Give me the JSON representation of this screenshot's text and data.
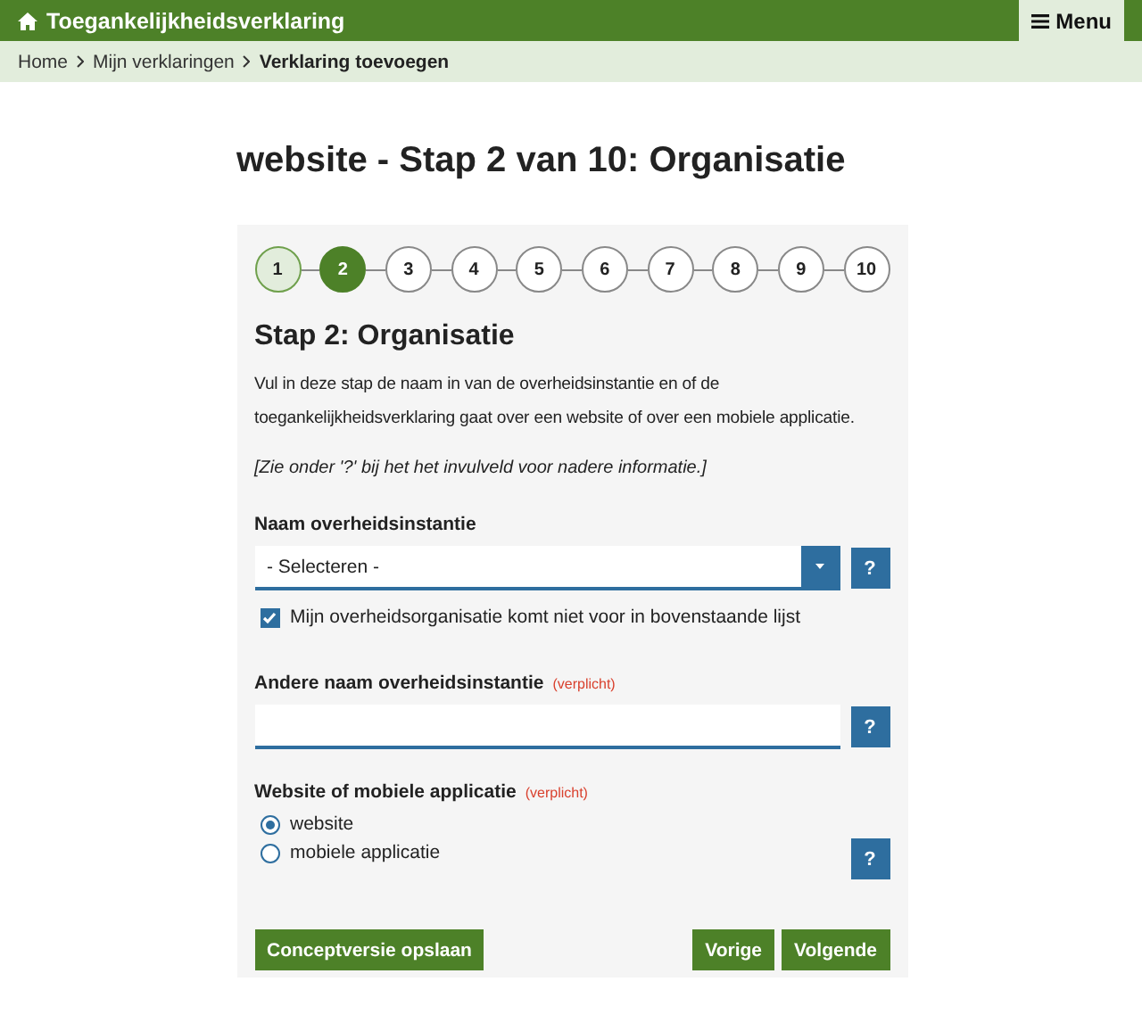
{
  "header": {
    "title": "Toegankelijkheidsverklaring",
    "menu": "Menu"
  },
  "breadcrumb": [
    {
      "label": "Home",
      "current": false
    },
    {
      "label": "Mijn verklaringen",
      "current": false
    },
    {
      "label": "Verklaring toevoegen",
      "current": true
    }
  ],
  "page_title": "website - Stap 2 van 10: Organisatie",
  "steps": [
    {
      "label": "1",
      "selected": false,
      "completed": true
    },
    {
      "label": "2",
      "selected": true,
      "completed": false
    },
    {
      "label": "3",
      "selected": false,
      "completed": false
    },
    {
      "label": "4",
      "selected": false,
      "completed": false
    },
    {
      "label": "5",
      "selected": false,
      "completed": false
    },
    {
      "label": "6",
      "selected": false,
      "completed": false
    },
    {
      "label": "7",
      "selected": false,
      "completed": false
    },
    {
      "label": "8",
      "selected": false,
      "completed": false
    },
    {
      "label": "9",
      "selected": false,
      "completed": false
    },
    {
      "label": "10",
      "selected": false,
      "completed": false
    }
  ],
  "step_heading": "Stap 2: Organisatie",
  "intro": "Vul in deze stap de naam in van de overheidsinstantie en of de toegankelijkheidsverklaring gaat over een website of over een mobiele applicatie.",
  "note": "[Zie onder '?' bij het het invulveld voor nadere informatie.]",
  "org_select": {
    "label": "Naam overheidsinstantie",
    "value": "- Selecteren -",
    "help": "?"
  },
  "not_listed": {
    "label": "Mijn overheidsorganisatie komt niet voor in bovenstaande lijst",
    "checked": true
  },
  "other_name": {
    "label": "Andere naam overheidsinstantie",
    "required": "(verplicht)",
    "help": "?"
  },
  "type": {
    "label": "Website of mobiele applicatie",
    "required": "(verplicht)",
    "help": "?",
    "options": [
      {
        "label": "website",
        "selected": true
      },
      {
        "label": "mobiele applicatie",
        "selected": false
      }
    ]
  },
  "buttons": {
    "save": "Conceptversie opslaan",
    "previous": "Vorige",
    "next": "Volgende"
  }
}
